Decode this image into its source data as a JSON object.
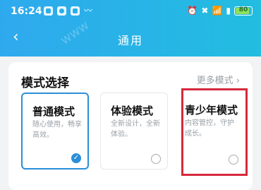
{
  "status_bar": {
    "time": "16:24",
    "battery_level": "80",
    "battery_color": "#8fe05a"
  },
  "header": {
    "title": "通用",
    "back_icon": "chevron-left-icon",
    "background": "#2fa9ee"
  },
  "section": {
    "title": "模式选择",
    "more_label": "更多模式",
    "more_icon": "chevron-right-icon"
  },
  "modes": [
    {
      "title": "普通模式",
      "desc": "随心使用，畅享高效。",
      "selected": true
    },
    {
      "title": "体验模式",
      "desc": "全新设计，全新体验。",
      "selected": false
    },
    {
      "title": "青少年模式",
      "desc": "内容管控，守护成长。",
      "selected": false
    }
  ],
  "accent_color": "#2a8fd8",
  "highlight_color": "#d6293b"
}
